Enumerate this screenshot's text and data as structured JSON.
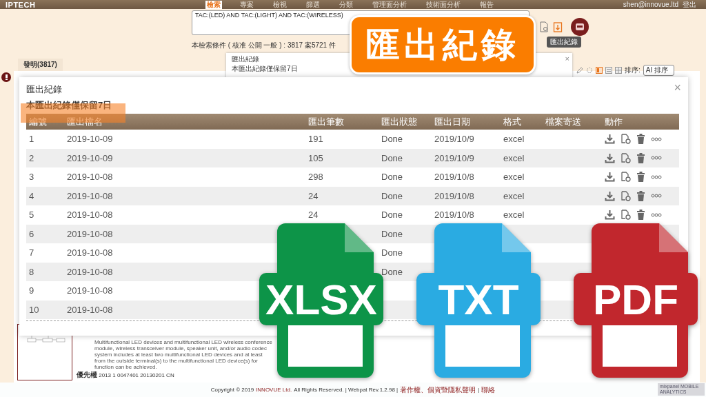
{
  "topbar": {
    "logo": "IPTECH",
    "nav": [
      {
        "label": "檢索",
        "selected": true
      },
      {
        "label": "專案",
        "selected": false
      },
      {
        "label": "檢視",
        "selected": false
      },
      {
        "label": "篩選",
        "selected": false
      },
      {
        "label": "分類",
        "selected": false
      },
      {
        "label": "管理面分析",
        "selected": false
      },
      {
        "label": "技術面分析",
        "selected": false
      },
      {
        "label": "報告",
        "selected": false
      }
    ],
    "user": "shen@innovue.ltd",
    "logout": "登出"
  },
  "search": {
    "query": "TAC:(LED) AND TAC:(LIGHT) AND TAC:(WIRELESS)",
    "conditions": "本檢索條件 ( 核准 公開 一般 ) : 3817 案5721 件",
    "tooltip": "匯出紀錄",
    "sort_label": "排序:",
    "sort_value": "AI 排序"
  },
  "popup": {
    "close": "×",
    "title": "匯出紀錄",
    "note": "本匯出紀錄僅保留7日"
  },
  "tab": {
    "label": "發明(3817)"
  },
  "result": {
    "abstract": [
      "Multifunctional LED devices and multifunctional LED wireless conference",
      "module, wireless transceiver module, speaker unit, and/or audio codec",
      "system includes at least two multifunctional LED devices and at least",
      "from the outside terminal(s) to the multifunctional LED device(s) for",
      "function can be achieved."
    ],
    "priority_label": "優先權",
    "priority": "2013 1 0047401  20130201  CN"
  },
  "footer": {
    "copyright": "Copyright © 2019",
    "company": "INNOVUE Ltd.",
    "rights": "All Rights Reserved. | Webpat Rev.1.2.98 |",
    "privacy": "著作權、個資暨隱私聲明",
    "sep": "|",
    "contact": "聯絡",
    "badge": "mixpanel MOBILE ANALYTICS"
  },
  "modal": {
    "close": "×",
    "title": "匯出紀錄",
    "note": "本匯出紀錄僅保留7日",
    "columns": [
      "編號",
      "匯出檔名",
      "匯出筆數",
      "匯出狀態",
      "匯出日期",
      "格式",
      "檔案寄送",
      "動作"
    ],
    "rows": [
      {
        "no": "1",
        "name": "2019-10-09",
        "count": "191",
        "status": "Done",
        "date": "2019/10/9",
        "format": "excel",
        "actions": true
      },
      {
        "no": "2",
        "name": "2019-10-09",
        "count": "105",
        "status": "Done",
        "date": "2019/10/9",
        "format": "excel",
        "actions": true
      },
      {
        "no": "3",
        "name": "2019-10-08",
        "count": "298",
        "status": "Done",
        "date": "2019/10/8",
        "format": "excel",
        "actions": true
      },
      {
        "no": "4",
        "name": "2019-10-08",
        "count": "24",
        "status": "Done",
        "date": "2019/10/8",
        "format": "excel",
        "actions": true
      },
      {
        "no": "5",
        "name": "2019-10-08",
        "count": "24",
        "status": "Done",
        "date": "2019/10/8",
        "format": "excel",
        "actions": true
      },
      {
        "no": "6",
        "name": "2019-10-08",
        "status": "Done"
      },
      {
        "no": "7",
        "name": "2019-10-08",
        "status": "Done"
      },
      {
        "no": "8",
        "name": "2019-10-08",
        "status": "Done"
      },
      {
        "no": "9",
        "name": "2019-10-08"
      },
      {
        "no": "10",
        "name": "2019-10-08"
      }
    ]
  },
  "callout": {
    "text": "匯出紀錄"
  },
  "file_types": [
    {
      "label": "XLSX",
      "color": "#0d9448"
    },
    {
      "label": "TXT",
      "color": "#2aabe2"
    },
    {
      "label": "PDF",
      "color": "#c1272d"
    }
  ]
}
